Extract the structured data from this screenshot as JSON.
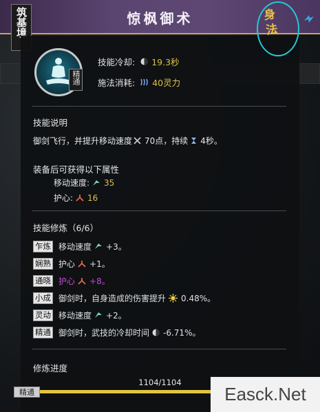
{
  "realm": "筑基境",
  "skill": {
    "title": "惊枫御术",
    "category": "身法",
    "level_tag": "精通",
    "icon": "meditating-figure-icon"
  },
  "stats": {
    "cooldown_label": "技能冷却:",
    "cooldown_value": "19.3秒",
    "cost_label": "施法消耗:",
    "cost_value": "40灵力"
  },
  "description": {
    "title": "技能说明",
    "text_before": "御剑飞行，并提升移动速度",
    "speed_value": "70点，持续",
    "duration_value": "4秒。"
  },
  "equip": {
    "title": "装备后可获得以下属性",
    "attrs": [
      {
        "label": "移动速度:",
        "value": "35",
        "icon": "speed-icon"
      },
      {
        "label": "护心:",
        "value": "16",
        "icon": "heart-guard-icon"
      }
    ]
  },
  "training": {
    "title": "技能修炼（6/6）",
    "rows": [
      {
        "tag": "乍炼",
        "text": "移动速度",
        "value": "+3。",
        "icon": "speed-icon"
      },
      {
        "tag": "娴熟",
        "text": "护心",
        "value": "+1。",
        "icon": "heart-guard-icon"
      },
      {
        "tag": "通晓",
        "text": "护心",
        "value": "+8。",
        "icon": "heart-guard-icon",
        "highlight": true
      },
      {
        "tag": "小成",
        "text": "御剑时，自身造成的伤害提升",
        "value": "0.48%。",
        "icon": "sun-burst-icon"
      },
      {
        "tag": "灵动",
        "text": "移动速度",
        "value": "+2。",
        "icon": "speed-icon"
      },
      {
        "tag": "精通",
        "text": "御剑时，武技的冷却时间",
        "value": "-6.71%。",
        "icon": "moon-icon"
      }
    ]
  },
  "progress": {
    "label": "修炼进度",
    "count": "1104/1104",
    "current": 1104,
    "max": 1104,
    "tag": "精通"
  },
  "watermark": "Easck.Net",
  "colors": {
    "header": "#5a4470",
    "accent_gold": "#d9c24a",
    "badge_ring": "#26c9d4",
    "highlight_purple": "#c24ad8"
  }
}
